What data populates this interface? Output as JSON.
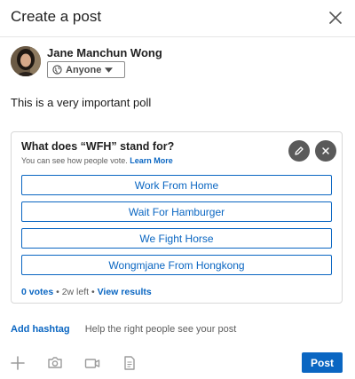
{
  "dialog": {
    "title": "Create a post",
    "close_icon": "close-icon"
  },
  "author": {
    "name": "Jane Manchun Wong",
    "avatar_icon": "avatar",
    "visibility_label": "Anyone",
    "visibility_icon": "globe-icon"
  },
  "post": {
    "text": "This is a very important poll"
  },
  "poll": {
    "question": "What does “WFH” stand for?",
    "note": "You can see how people vote.",
    "learn_more": "Learn More",
    "options": [
      "Work From Home",
      "Wait For Hamburger",
      "We Fight Horse",
      "Wongmjane From Hongkong"
    ],
    "votes": "0 votes",
    "time_left": "2w left",
    "view_results": "View results",
    "separator": "•"
  },
  "hashtag": {
    "add_label": "Add hashtag",
    "help_text": "Help the right people see your post"
  },
  "toolbar": {
    "icons": [
      "plus-icon",
      "camera-icon",
      "video-icon",
      "document-icon"
    ],
    "post_label": "Post"
  },
  "colors": {
    "accent": "#0a66c2",
    "muted_icon": "#9b9b9b",
    "dark_button": "#5a5a5a"
  }
}
